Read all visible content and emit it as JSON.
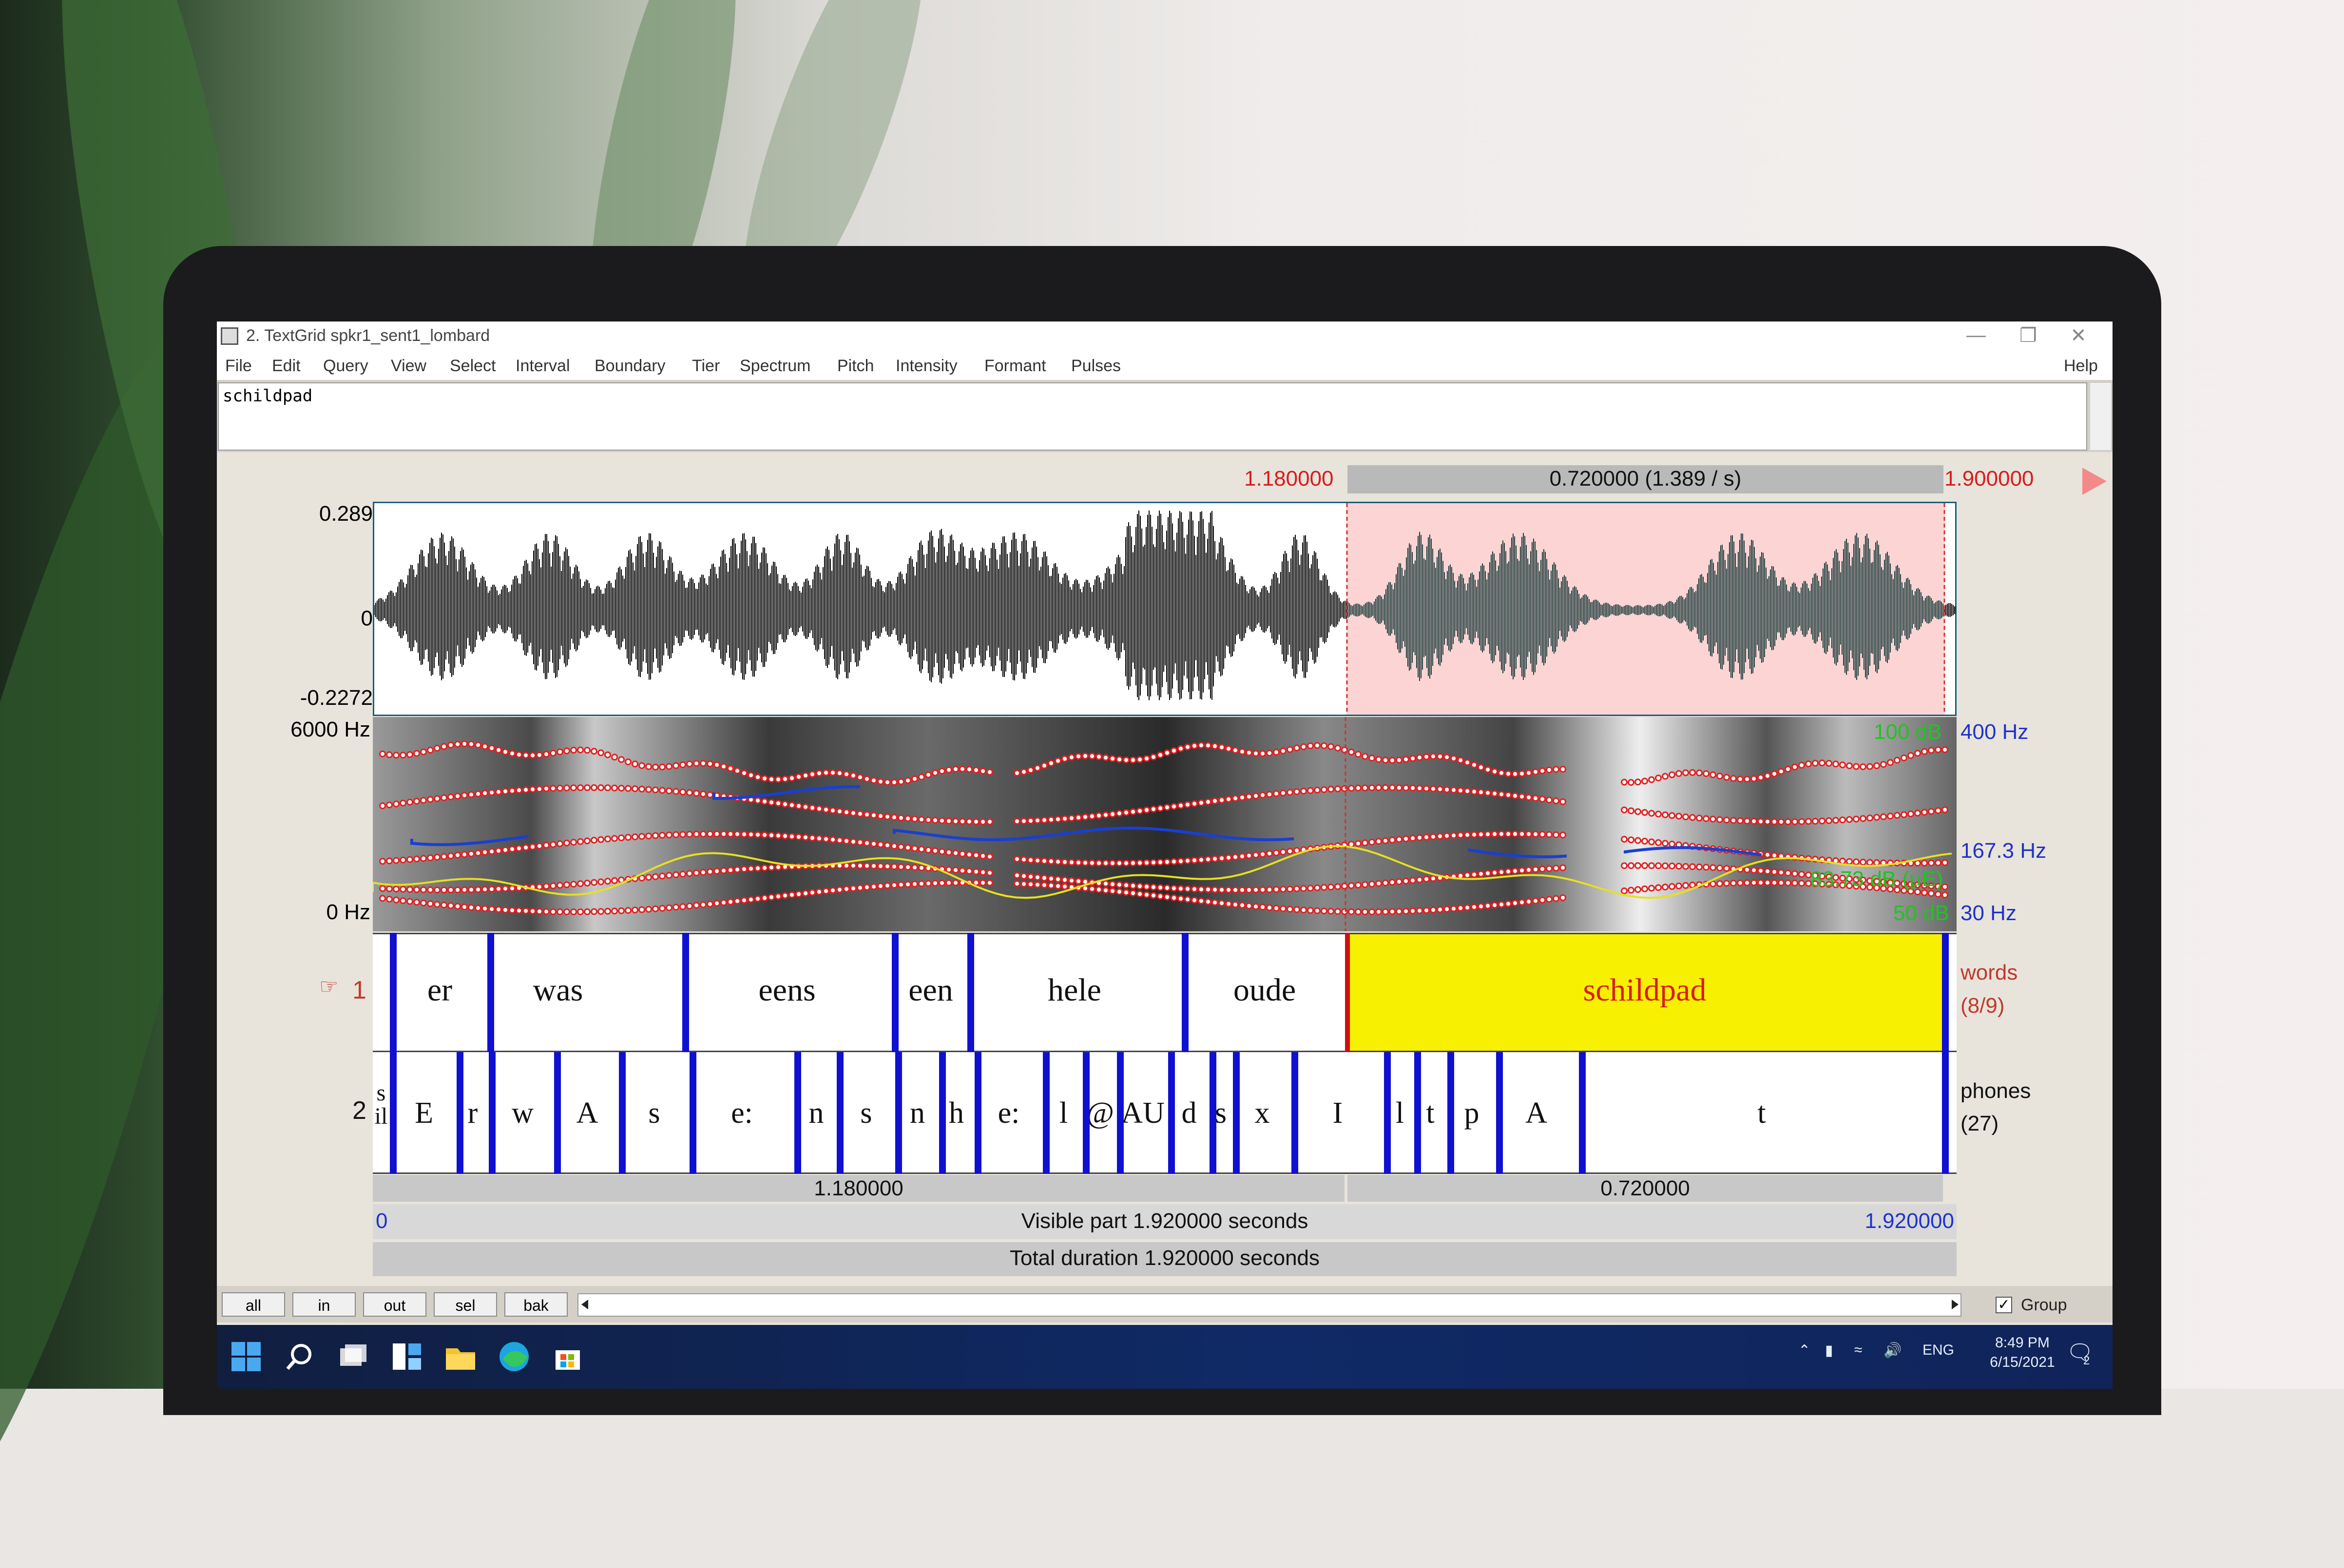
{
  "window": {
    "title": "2. TextGrid spkr1_sent1_lombard",
    "help": "Help",
    "menus": [
      "File",
      "Edit",
      "Query",
      "View",
      "Select",
      "Interval",
      "Boundary",
      "Tier",
      "Spectrum",
      "Pitch",
      "Intensity",
      "Formant",
      "Pulses"
    ]
  },
  "text_field": {
    "value": "schildpad"
  },
  "selection": {
    "start": "1.180000",
    "duration_label": "0.720000 (1.389 / s)",
    "end": "1.900000"
  },
  "waveform": {
    "ymax": "0.289",
    "yzero": "0",
    "ymin": "-0.2272"
  },
  "spectrogram": {
    "fmax": "6000 Hz",
    "fmin": "0 Hz",
    "pitch_top": "400 Hz",
    "pitch_mid": "167.3 Hz",
    "pitch_bottom": "30 Hz",
    "intensity_top": "100 dB",
    "intensity_mid": "83.73 dB (μE)",
    "intensity_bottom": "50 dB"
  },
  "tiers": {
    "tier1": {
      "number": "1",
      "pointer": "☞",
      "name": "words",
      "count": "(8/9)",
      "intervals": [
        "er",
        "was",
        "eens",
        "een",
        "hele",
        "oude",
        "schildpad"
      ]
    },
    "tier2": {
      "number": "2",
      "name": "phones",
      "count": "(27)",
      "intervals": [
        "s\nil",
        "E",
        "r",
        "w",
        "A",
        "s",
        "e:",
        "n",
        "s",
        "n",
        "h",
        "e:",
        "l",
        "@",
        "AU",
        "d",
        "s",
        "x",
        "I",
        "l",
        "t",
        "p",
        "A",
        "t"
      ]
    }
  },
  "time_axis": {
    "left_segment": "1.180000",
    "right_segment": "0.720000",
    "visible_start": "0",
    "visible_label": "Visible part 1.920000 seconds",
    "visible_end": "1.920000",
    "total_label": "Total duration 1.920000 seconds"
  },
  "zoom_buttons": [
    "all",
    "in",
    "out",
    "sel",
    "bak"
  ],
  "group": {
    "label": "Group",
    "checked": true
  },
  "taskbar": {
    "lang": "ENG",
    "time": "8:49 PM",
    "date": "6/15/2021",
    "notifications": "2"
  },
  "colors": {
    "selection_bg": "#fcd4d4",
    "selected_interval": "#f7f000",
    "boundary": "#1010d0",
    "formant": "#e02020",
    "pitch": "#1a3fd0",
    "intensity": "#e8e020"
  }
}
